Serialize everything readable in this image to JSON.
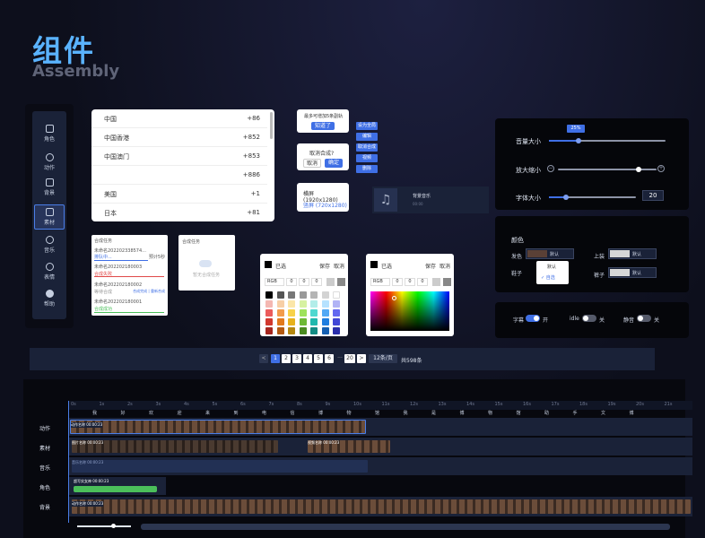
{
  "header": {
    "title": "组件",
    "subtitle": "Assembly"
  },
  "sidebar": {
    "items": [
      {
        "label": "角色",
        "icon": "image-icon"
      },
      {
        "label": "动作",
        "icon": "person-icon"
      },
      {
        "label": "背景",
        "icon": "layers-icon"
      },
      {
        "label": "素材",
        "icon": "folder-icon"
      },
      {
        "label": "音乐",
        "icon": "music-icon"
      },
      {
        "label": "表情",
        "icon": "smile-icon"
      },
      {
        "label": "帮助",
        "icon": "help-icon"
      }
    ],
    "active": "素材"
  },
  "country_list": [
    {
      "name": "中国",
      "code": "+86"
    },
    {
      "name": "中国香港",
      "code": "+852"
    },
    {
      "name": "中国澳门",
      "code": "+853"
    },
    {
      "name": "",
      "code": "+886"
    },
    {
      "name": "美国",
      "code": "+1"
    },
    {
      "name": "日本",
      "code": "+81"
    }
  ],
  "popover1": {
    "text": "最多可增加5条副轨",
    "button": "知道了"
  },
  "popover2": {
    "text": "取消合成?",
    "cancel": "取消",
    "ok": "确定"
  },
  "context_tags": [
    "设为全局",
    "编辑",
    "取消合成",
    "视频",
    "删除"
  ],
  "popover3": {
    "option1": "横屏 (1920x1280)",
    "option2": "竖屏 (720x1280)"
  },
  "music": {
    "title": "背景音乐",
    "time": "00:00"
  },
  "sliders": {
    "volume": {
      "label": "音量大小",
      "value": "25%",
      "pct": 25
    },
    "zoom": {
      "label": "放大缩小",
      "pct": 82
    },
    "font": {
      "label": "字体大小",
      "value": "20",
      "pct": 20
    }
  },
  "colors": {
    "title": "颜色",
    "hair": {
      "label": "发色",
      "value": "默认",
      "swatch": "#5a4036"
    },
    "top": {
      "label": "上装",
      "value": "默认",
      "swatch": "#d6d6d6"
    },
    "pants": {
      "label": "裤子",
      "swatch": "#d6d6d6"
    },
    "shoes": {
      "label": "鞋子",
      "value": "默认",
      "swatch": "#d6d6d6"
    },
    "dropdown": [
      "默认",
      "自选"
    ]
  },
  "toggles": [
    {
      "label": "字幕",
      "state": "开",
      "on": true
    },
    {
      "label": "idle",
      "state": "关",
      "on": false
    },
    {
      "label": "静音",
      "state": "关",
      "on": false
    }
  ],
  "task": {
    "title": "合成任务",
    "items": [
      {
        "name": "未命名202202338574...",
        "status": "排队中...",
        "extra": "预计5秒"
      },
      {
        "name": "未命名202202180003",
        "status": "合成失败"
      },
      {
        "name": "未命名202202180002",
        "status": "等待合成",
        "extra": "合成完成 | 重新合成"
      },
      {
        "name": "未命名202202180001",
        "status": "合成成功"
      }
    ]
  },
  "task2": {
    "title": "合成任务",
    "empty": "暂无合成任务"
  },
  "picker1": {
    "label": "已选",
    "save": "保存",
    "cancel": "取消",
    "mode": "RGB",
    "r": "0",
    "g": "0",
    "b": "0"
  },
  "picker2": {
    "label": "已选",
    "save": "保存",
    "cancel": "取消",
    "mode": "RGB",
    "r": "0",
    "g": "0",
    "b": "0"
  },
  "palette": [
    "#000000",
    "#555555",
    "#777777",
    "#999999",
    "#b5b5b5",
    "#d3d3d3",
    "#ffffff",
    "#f4b7b1",
    "#f7cfa6",
    "#fbe6a8",
    "#d7f1a1",
    "#b2ede9",
    "#b6e2ff",
    "#b1b3f5",
    "#eb5b5b",
    "#f29c4c",
    "#f7d24a",
    "#9ee25b",
    "#4fd8d0",
    "#52a9f5",
    "#6368f0",
    "#d1382e",
    "#e27a1d",
    "#e7b21c",
    "#6eb935",
    "#1fb8ae",
    "#1f7ee0",
    "#4146d6",
    "#a6261f",
    "#b45a12",
    "#b58810",
    "#4a8b20",
    "#128b84",
    "#155fb2",
    "#2a2eab"
  ],
  "pagination": {
    "pages": [
      "1",
      "2",
      "3",
      "4",
      "5",
      "6",
      "···",
      "20"
    ],
    "current": "1",
    "per_page": "12条/页",
    "total": "共598条",
    "prev": "<",
    "next": ">"
  },
  "timeline": {
    "ticks": [
      "0s",
      "1s",
      "2s",
      "3s",
      "4s",
      "5s",
      "6s",
      "7s",
      "8s",
      "9s",
      "10s",
      "11s",
      "12s",
      "13s",
      "14s",
      "15s",
      "16s",
      "17s",
      "18s",
      "19s",
      "20s",
      "21s"
    ],
    "subtitles": [
      "我",
      "好",
      "欢",
      "迎",
      "来",
      "到",
      "电",
      "信",
      "博",
      "物",
      "馆",
      "我",
      "是",
      "博",
      "物",
      "馆",
      "助",
      "手",
      "文",
      "博"
    ],
    "rows": [
      {
        "label": "动作",
        "clips": [
          {
            "name": "动作名称",
            "time": "00:00:23"
          }
        ]
      },
      {
        "label": "素材",
        "clips": [
          {
            "name": "图片名称",
            "time": "00:00:23"
          },
          {
            "name": "视频名称",
            "time": "00:00:23"
          }
        ]
      },
      {
        "label": "音乐",
        "clips": [
          {
            "name": "音乐名称",
            "time": "00:00:23"
          }
        ]
      },
      {
        "label": "角色",
        "clips": [
          {
            "name": "超写实女神",
            "time": "00:00:23"
          }
        ]
      },
      {
        "label": "背景",
        "clips": [
          {
            "name": "动作名称",
            "time": "00:00:23"
          }
        ]
      }
    ]
  }
}
